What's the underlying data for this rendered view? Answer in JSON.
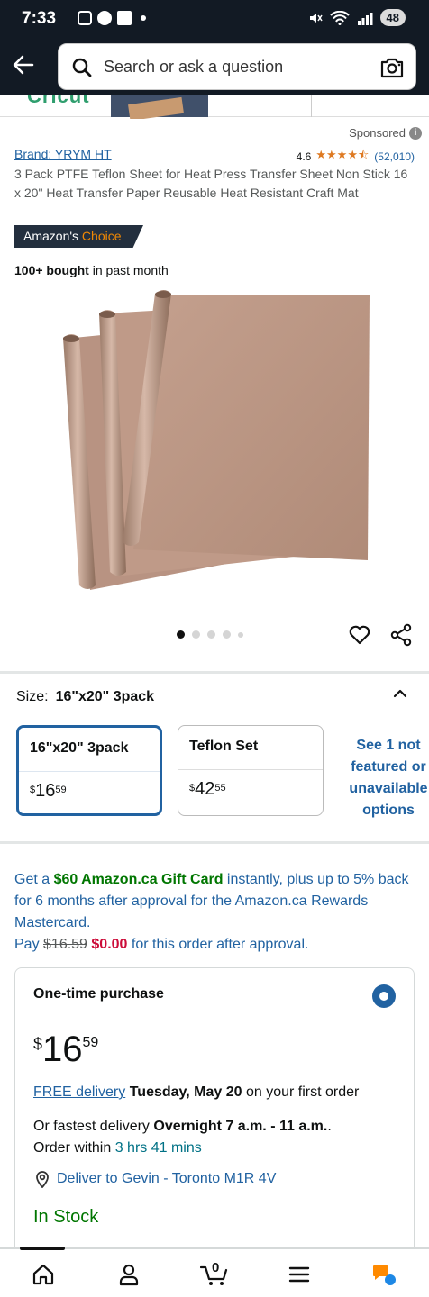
{
  "status_bar": {
    "time": "7:33",
    "battery": "48"
  },
  "search": {
    "placeholder": "Search or ask a question"
  },
  "ad_strip": {
    "brand_text": "Cricut"
  },
  "sponsored": {
    "label": "Sponsored"
  },
  "product": {
    "brand": "Brand: YRYM HT",
    "rating": "4.6",
    "stars": "★★★★⯪",
    "review_count": "(52,010)",
    "title": "3 Pack PTFE Teflon Sheet for Heat Press Transfer Sheet Non Stick 16 x 20\" Heat Transfer Paper Reusable Heat Resistant Craft Mat",
    "badge_prefix": "Amazon's ",
    "badge_suffix": "Choice",
    "bought_bold": "100+ bought",
    "bought_rest": " in past month",
    "image_count": 5,
    "image_active_index": 1
  },
  "size_selector": {
    "label": "Size:",
    "selected": "16\"x20\" 3pack",
    "options": [
      {
        "label": "16\"x20\" 3pack",
        "price_dollar": "$",
        "price_whole": "16",
        "price_cents": "59",
        "selected": true
      },
      {
        "label": "Teflon Set",
        "price_dollar": "$",
        "price_whole": "42",
        "price_cents": "55",
        "selected": false
      }
    ],
    "see_more": "See 1 not featured or unavailable options"
  },
  "gift_offer": {
    "p1": "Get a ",
    "amount": "$60 Amazon.ca Gift Card",
    "p2": " instantly, plus up to 5% back for 6 months after approval for the Amazon.ca Rewards Mastercard.",
    "pay": "Pay ",
    "old_price": "$16.59",
    "new_price": "$0.00",
    "p3": " for this order after approval."
  },
  "purchase_card": {
    "title": "One-time purchase",
    "price_currency": "$",
    "price_whole": "16",
    "price_cents": "59",
    "free_delivery": "FREE delivery",
    "delivery_date": "Tuesday, May 20",
    "delivery_rest": " on your first order",
    "fastest_prefix": "Or fastest delivery ",
    "fastest_time": "Overnight 7 a.m. - 11 a.m.",
    "fastest_suffix": ".",
    "order_within": "Order within ",
    "countdown": "3 hrs 41 mins",
    "deliver_to": "Deliver to Gevin - Toronto M1R 4V",
    "stock": "In Stock"
  },
  "bottom_nav": {
    "cart_count": "0"
  }
}
